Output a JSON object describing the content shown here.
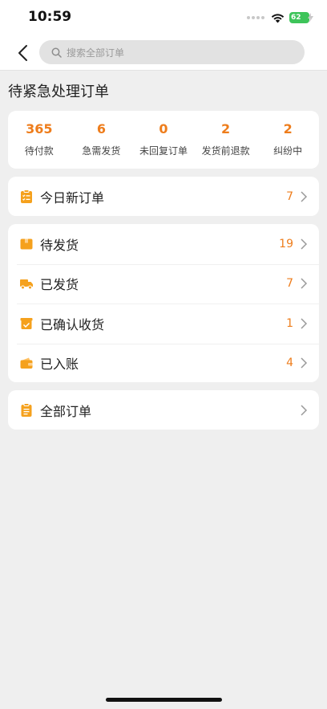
{
  "status_bar": {
    "time": "10:59",
    "battery": "62"
  },
  "nav": {
    "search_placeholder": "搜索全部订单"
  },
  "section_title": "待紧急处理订单",
  "stats": [
    {
      "value": "365",
      "label": "待付款"
    },
    {
      "value": "6",
      "label": "急需发货"
    },
    {
      "value": "0",
      "label": "未回复订单"
    },
    {
      "value": "2",
      "label": "发货前退款"
    },
    {
      "value": "2",
      "label": "纠纷中"
    }
  ],
  "today": {
    "label": "今日新订单",
    "count": "7",
    "icon": "clipboard-list-icon"
  },
  "order_status": [
    {
      "label": "待发货",
      "count": "19",
      "icon": "box-icon"
    },
    {
      "label": "已发货",
      "count": "7",
      "icon": "truck-icon"
    },
    {
      "label": "已确认收货",
      "count": "1",
      "icon": "checked-box-icon"
    },
    {
      "label": "已入账",
      "count": "4",
      "icon": "wallet-icon"
    }
  ],
  "all_orders": {
    "label": "全部订单",
    "icon": "document-icon"
  },
  "colors": {
    "accent": "#ee7d1c",
    "background": "#efefef",
    "card": "#ffffff"
  }
}
